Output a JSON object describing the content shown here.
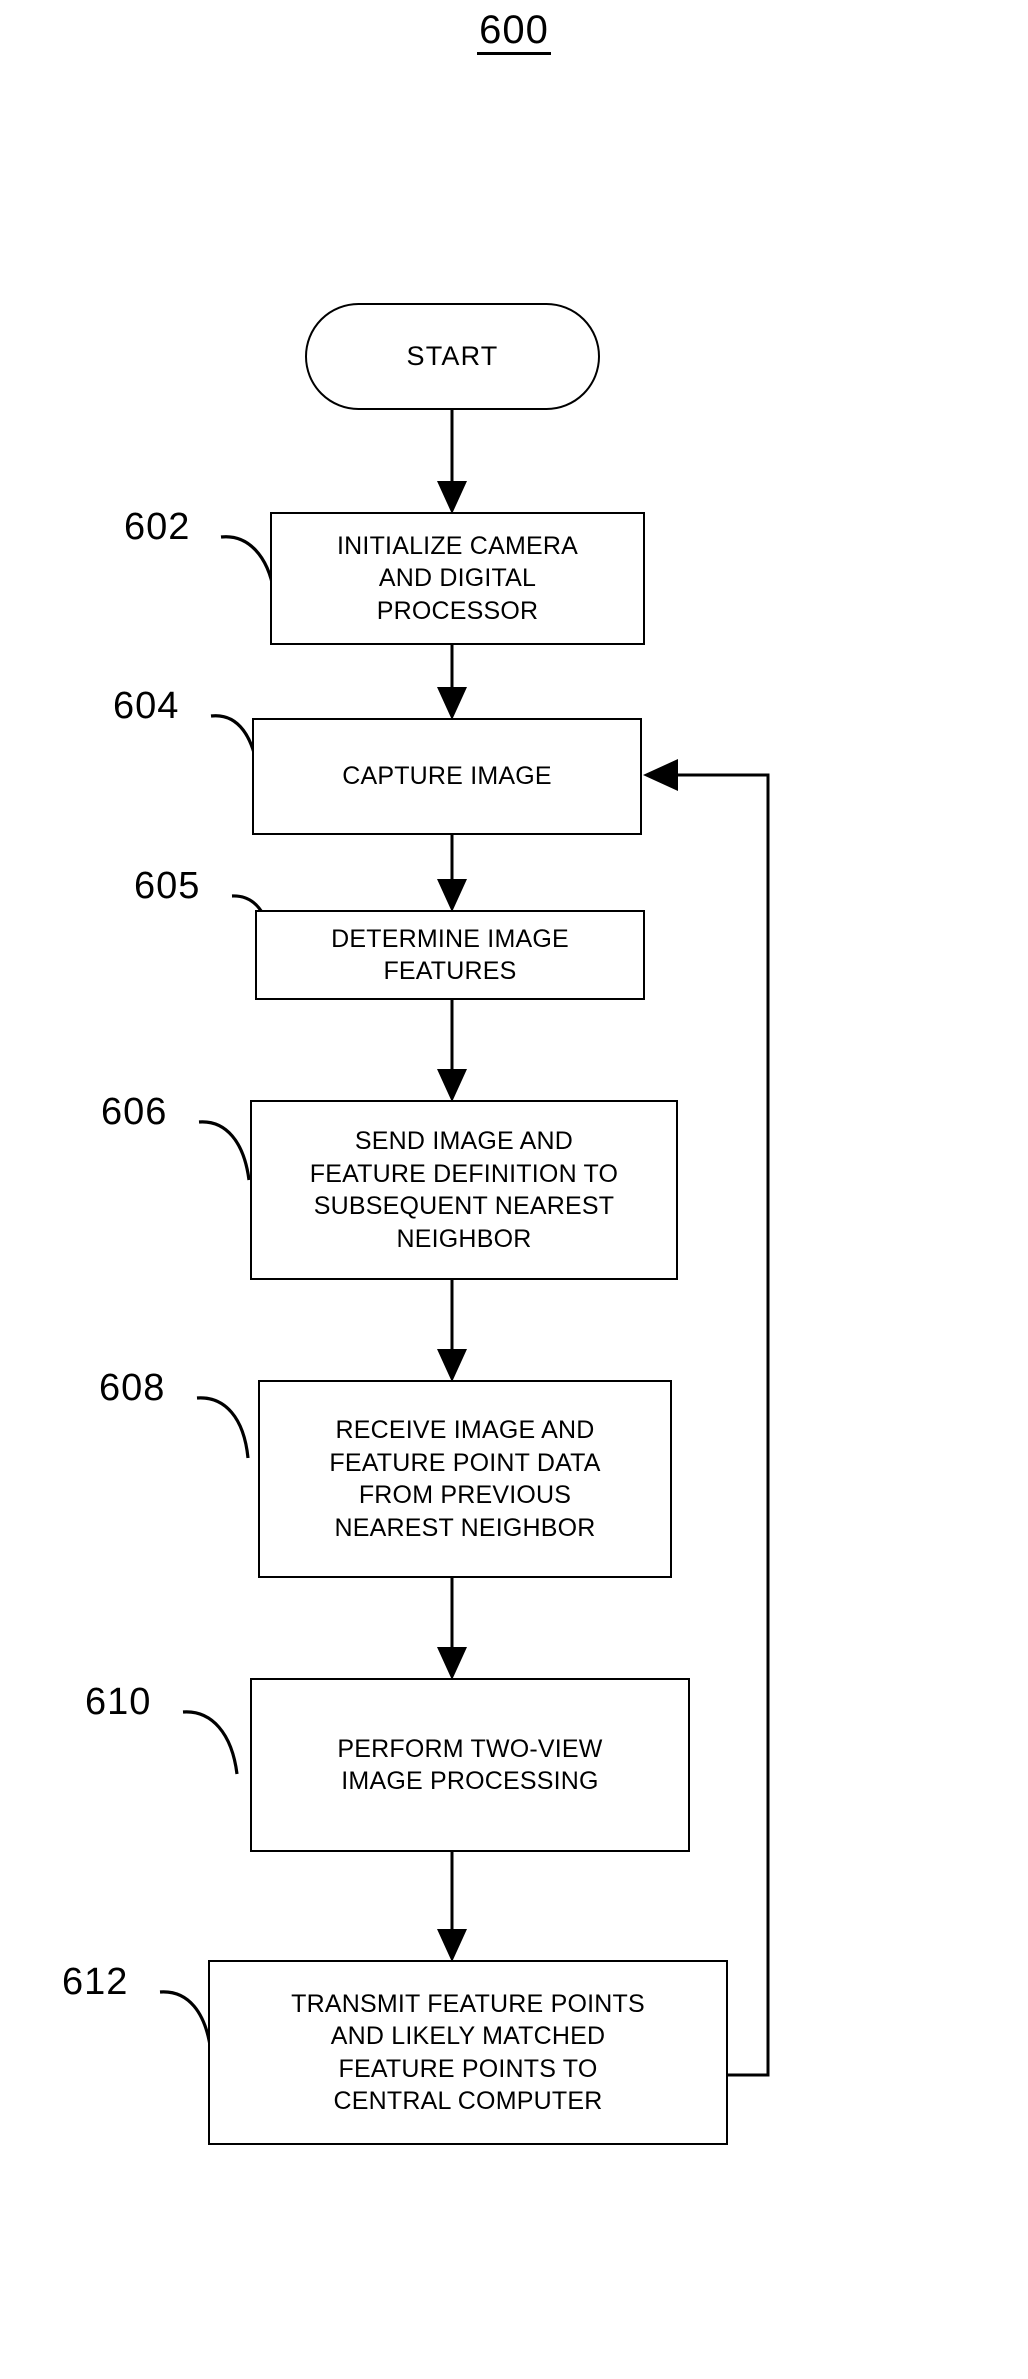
{
  "figure": {
    "number": "600",
    "underlined": true
  },
  "flowchart": {
    "title": "600",
    "nodes": [
      {
        "id": "start",
        "ref": "",
        "shape": "terminator",
        "text": "START"
      },
      {
        "id": "n602",
        "ref": "602",
        "shape": "process",
        "text": "INITIALIZE CAMERA\nAND DIGITAL\nPROCESSOR"
      },
      {
        "id": "n604",
        "ref": "604",
        "shape": "process",
        "text": "CAPTURE IMAGE"
      },
      {
        "id": "n605",
        "ref": "605",
        "shape": "process",
        "text": "DETERMINE IMAGE\nFEATURES"
      },
      {
        "id": "n606",
        "ref": "606",
        "shape": "process",
        "text": "SEND IMAGE AND\nFEATURE DEFINITION TO\nSUBSEQUENT NEAREST\nNEIGHBOR"
      },
      {
        "id": "n608",
        "ref": "608",
        "shape": "process",
        "text": "RECEIVE  IMAGE AND\nFEATURE POINT DATA\nFROM PREVIOUS\nNEAREST NEIGHBOR"
      },
      {
        "id": "n610",
        "ref": "610",
        "shape": "process",
        "text": "PERFORM TWO-VIEW\nIMAGE PROCESSING"
      },
      {
        "id": "n612",
        "ref": "612",
        "shape": "process",
        "text": "TRANSMIT FEATURE POINTS\nAND LIKELY MATCHED\nFEATURE POINTS TO\nCENTRAL COMPUTER"
      }
    ],
    "edges": [
      {
        "from": "start",
        "to": "n602",
        "kind": "arrow-down"
      },
      {
        "from": "n602",
        "to": "n604",
        "kind": "arrow-down"
      },
      {
        "from": "n604",
        "to": "n605",
        "kind": "arrow-down"
      },
      {
        "from": "n605",
        "to": "n606",
        "kind": "arrow-down"
      },
      {
        "from": "n606",
        "to": "n608",
        "kind": "arrow-down"
      },
      {
        "from": "n608",
        "to": "n610",
        "kind": "arrow-down"
      },
      {
        "from": "n610",
        "to": "n612",
        "kind": "arrow-down"
      },
      {
        "from": "n612",
        "to": "n604",
        "kind": "feedback-loop-right"
      }
    ],
    "colors": {
      "stroke": "#000000",
      "fill": "#ffffff",
      "text": "#000000"
    }
  }
}
